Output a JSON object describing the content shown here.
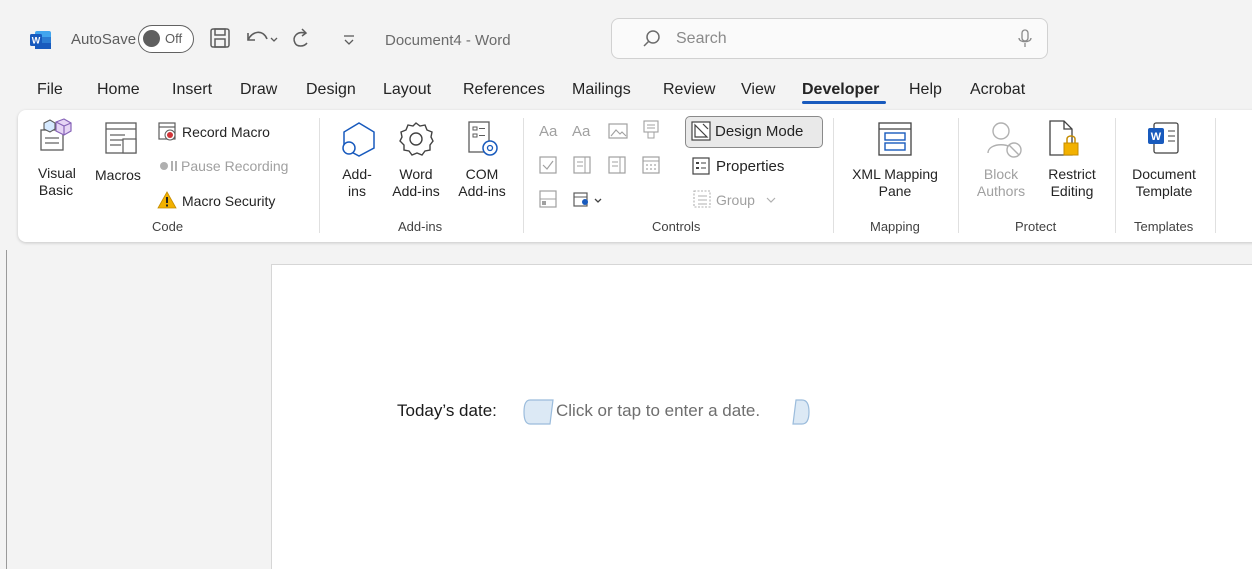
{
  "titlebar": {
    "autosave_label": "AutoSave",
    "autosave_state": "Off",
    "document_title": "Document4  -  Word",
    "search_placeholder": "Search"
  },
  "tabs": [
    "File",
    "Home",
    "Insert",
    "Draw",
    "Design",
    "Layout",
    "References",
    "Mailings",
    "Review",
    "View",
    "Developer",
    "Help",
    "Acrobat"
  ],
  "active_tab": "Developer",
  "ribbon": {
    "code": {
      "label": "Code",
      "visual_basic": [
        "Visual",
        "Basic"
      ],
      "macros": "Macros",
      "record_macro": "Record Macro",
      "pause_recording": "Pause Recording",
      "macro_security": "Macro Security"
    },
    "addins": {
      "label": "Add-ins",
      "addins": [
        "Add-",
        "ins"
      ],
      "word_addins": [
        "Word",
        "Add-ins"
      ],
      "com_addins": [
        "COM",
        "Add-ins"
      ]
    },
    "controls": {
      "label": "Controls",
      "aa1": "Aa",
      "aa2": "Aa",
      "design_mode": "Design Mode",
      "properties": "Properties",
      "group": "Group"
    },
    "mapping": {
      "label": "Mapping",
      "xml_mapping_pane": [
        "XML Mapping",
        "Pane"
      ]
    },
    "protect": {
      "label": "Protect",
      "block_authors": [
        "Block",
        "Authors"
      ],
      "restrict_editing": [
        "Restrict",
        "Editing"
      ]
    },
    "templates": {
      "label": "Templates",
      "document_template": [
        "Document",
        "Template"
      ]
    }
  },
  "document": {
    "date_label": "Today’s date:",
    "date_placeholder": "Click or tap to enter a date."
  },
  "colors": {
    "accent": "#185abd",
    "warning": "#f2b100",
    "record": "#d13438"
  }
}
